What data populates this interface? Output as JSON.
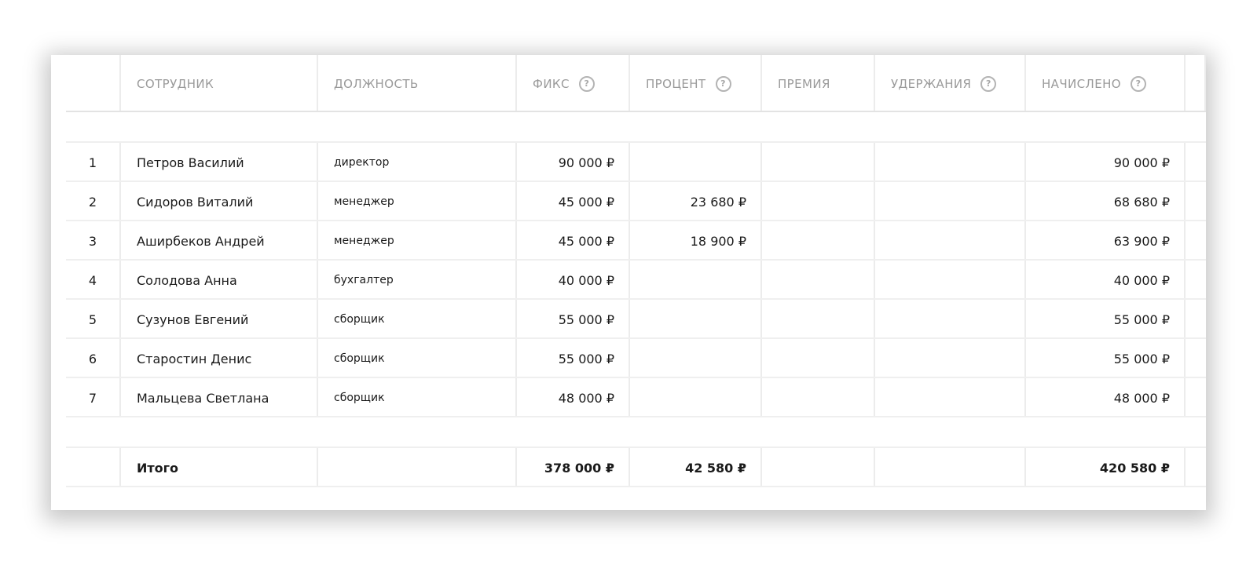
{
  "table": {
    "columns": {
      "employee": "СОТРУДНИК",
      "position": "ДОЛЖНОСТЬ",
      "fixed": "ФИКС",
      "percent": "ПРОЦЕНТ",
      "bonus": "ПРЕМИЯ",
      "deductions": "УДЕРЖАНИЯ",
      "accrued": "НАЧИСЛЕНО"
    },
    "help_glyph": "?",
    "rows": [
      {
        "num": "1",
        "employee": "Петров Василий",
        "position": "директор",
        "fixed": "90 000 ₽",
        "percent": "",
        "bonus": "",
        "deductions": "",
        "accrued": "90 000 ₽"
      },
      {
        "num": "2",
        "employee": "Сидоров Виталий",
        "position": "менеджер",
        "fixed": "45 000 ₽",
        "percent": "23 680 ₽",
        "bonus": "",
        "deductions": "",
        "accrued": "68 680 ₽"
      },
      {
        "num": "3",
        "employee": "Аширбеков Андрей",
        "position": "менеджер",
        "fixed": "45 000 ₽",
        "percent": "18 900 ₽",
        "bonus": "",
        "deductions": "",
        "accrued": "63 900 ₽"
      },
      {
        "num": "4",
        "employee": "Солодова Анна",
        "position": "бухгалтер",
        "fixed": "40 000 ₽",
        "percent": "",
        "bonus": "",
        "deductions": "",
        "accrued": "40 000 ₽"
      },
      {
        "num": "5",
        "employee": "Сузунов Евгений",
        "position": "сборщик",
        "fixed": "55 000 ₽",
        "percent": "",
        "bonus": "",
        "deductions": "",
        "accrued": "55 000 ₽"
      },
      {
        "num": "6",
        "employee": "Старостин Денис",
        "position": "сборщик",
        "fixed": "55 000 ₽",
        "percent": "",
        "bonus": "",
        "deductions": "",
        "accrued": "55 000 ₽"
      },
      {
        "num": "7",
        "employee": "Мальцева Светлана",
        "position": "сборщик",
        "fixed": "48 000 ₽",
        "percent": "",
        "bonus": "",
        "deductions": "",
        "accrued": "48 000 ₽"
      }
    ],
    "total": {
      "label": "Итого",
      "fixed": "378 000 ₽",
      "percent": "42 580 ₽",
      "accrued": "420 580 ₽"
    }
  }
}
